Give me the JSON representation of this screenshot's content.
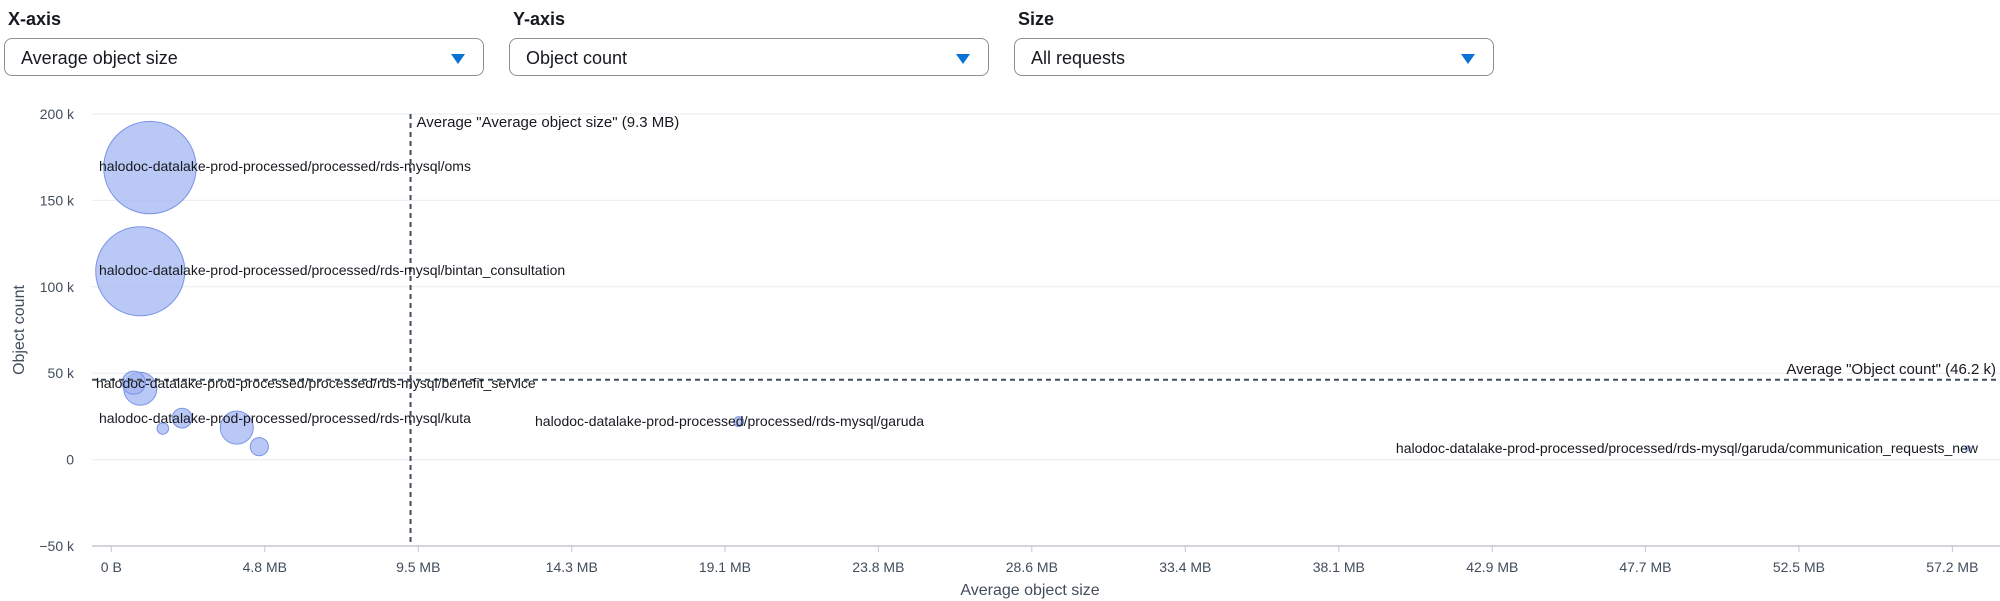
{
  "controls": {
    "x_axis": {
      "label": "X-axis",
      "value": "Average object size"
    },
    "y_axis": {
      "label": "Y-axis",
      "value": "Object count"
    },
    "size": {
      "label": "Size",
      "value": "All requests"
    }
  },
  "colors": {
    "bubble_fill": "#a3b5f2",
    "bubble_stroke": "#7a93e6",
    "grid": "#e9ebed",
    "axis": "#c6c6cd",
    "caret": "#0972d3"
  },
  "chart_data": {
    "type": "scatter",
    "xlabel": "Average object size",
    "ylabel": "Object count",
    "x_unit": "MB",
    "xlim": [
      -0.6,
      58.7
    ],
    "ylim": [
      -50000,
      200000
    ],
    "x_ticks": [
      {
        "value": 0,
        "label": "0 B"
      },
      {
        "value": 4.77,
        "label": "4.8 MB"
      },
      {
        "value": 9.54,
        "label": "9.5 MB"
      },
      {
        "value": 14.31,
        "label": "14.3 MB"
      },
      {
        "value": 19.07,
        "label": "19.1 MB"
      },
      {
        "value": 23.84,
        "label": "23.8 MB"
      },
      {
        "value": 28.61,
        "label": "28.6 MB"
      },
      {
        "value": 33.38,
        "label": "33.4 MB"
      },
      {
        "value": 38.15,
        "label": "38.1 MB"
      },
      {
        "value": 42.92,
        "label": "42.9 MB"
      },
      {
        "value": 47.68,
        "label": "47.7 MB"
      },
      {
        "value": 52.45,
        "label": "52.5 MB"
      },
      {
        "value": 57.22,
        "label": "57.2 MB"
      }
    ],
    "y_ticks": [
      {
        "value": 200000,
        "label": "200 k"
      },
      {
        "value": 150000,
        "label": "150 k"
      },
      {
        "value": 100000,
        "label": "100 k"
      },
      {
        "value": 50000,
        "label": "50 k"
      },
      {
        "value": 0,
        "label": "0"
      },
      {
        "value": -50000,
        "label": "−50 k"
      }
    ],
    "reference_lines": [
      {
        "axis": "x",
        "value": 9.3,
        "label": "Average \"Average object size\" (9.3 MB)"
      },
      {
        "axis": "y",
        "value": 46200,
        "label": "Average \"Object count\" (46.2 k)"
      }
    ],
    "points": [
      {
        "x": 1.2,
        "y": 169000,
        "size": 28,
        "label": "halodoc-datalake-prod-processed/processed/rds-mysql/oms"
      },
      {
        "x": 0.9,
        "y": 109000,
        "size": 27,
        "label": "halodoc-datalake-prod-processed/processed/rds-mysql/bintan_consultation"
      },
      {
        "x": 0.9,
        "y": 41000,
        "size": 10,
        "label": ""
      },
      {
        "x": 0.7,
        "y": 44500,
        "size": 7,
        "label": "halodoc-datalake-prod-processed/processed/rds-mysql/benefit_service"
      },
      {
        "x": 2.2,
        "y": 24000,
        "size": 6,
        "label": ""
      },
      {
        "x": 1.6,
        "y": 18000,
        "size": 3.5,
        "label": ""
      },
      {
        "x": 3.9,
        "y": 18500,
        "size": 10,
        "label": "halodoc-datalake-prod-processed/processed/rds-mysql/kuta"
      },
      {
        "x": 4.6,
        "y": 7500,
        "size": 5.5,
        "label": ""
      },
      {
        "x": 19.5,
        "y": 22000,
        "size": 3,
        "label": "halodoc-datalake-prod-processed/processed/rds-mysql/garuda"
      },
      {
        "x": 57.7,
        "y": 6500,
        "size": 1.5,
        "label": "halodoc-datalake-prod-processed/processed/rds-mysql/garuda/communication_requests_new"
      }
    ]
  }
}
